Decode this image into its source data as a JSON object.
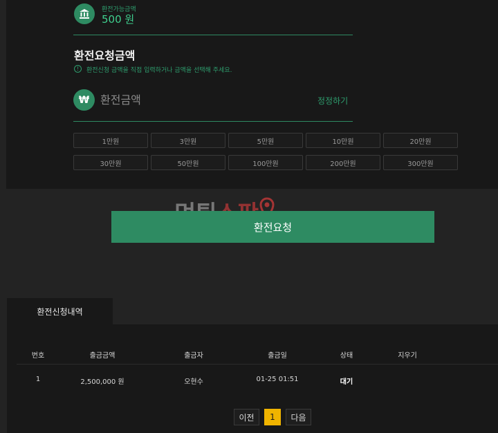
{
  "balance": {
    "label": "환전가능금액",
    "value": "500 원",
    "icon": "bank-icon"
  },
  "request": {
    "title": "환전요청금액",
    "notice": "환전신청 금액을 직접 입력하거나 금액을 선택해 주세요.",
    "amount_placeholder": "환전금액",
    "correct_label": "정정하기",
    "icon": "won-icon"
  },
  "amount_buttons": [
    "1만원",
    "3만원",
    "5만원",
    "10만원",
    "20만원",
    "30만원",
    "50만원",
    "100만원",
    "200만원",
    "300만원"
  ],
  "watermark": {
    "part1": "먹튀",
    "part2": "스팟"
  },
  "submit_label": "환전요청",
  "history": {
    "tab_label": "환전신청내역",
    "headers": [
      "번호",
      "출금금액",
      "출금자",
      "출금일",
      "상태",
      "지우기"
    ],
    "rows": [
      {
        "no": "1",
        "amount": "2,500,000 원",
        "name": "오현수",
        "date": "01-25 01:51",
        "status": "대기"
      }
    ]
  },
  "pagination": {
    "prev": "이전",
    "current": "1",
    "next": "다음"
  },
  "colors": {
    "accent": "#2e8b62",
    "page_active": "#f0b400",
    "background": "#232323",
    "panel": "#181818"
  }
}
